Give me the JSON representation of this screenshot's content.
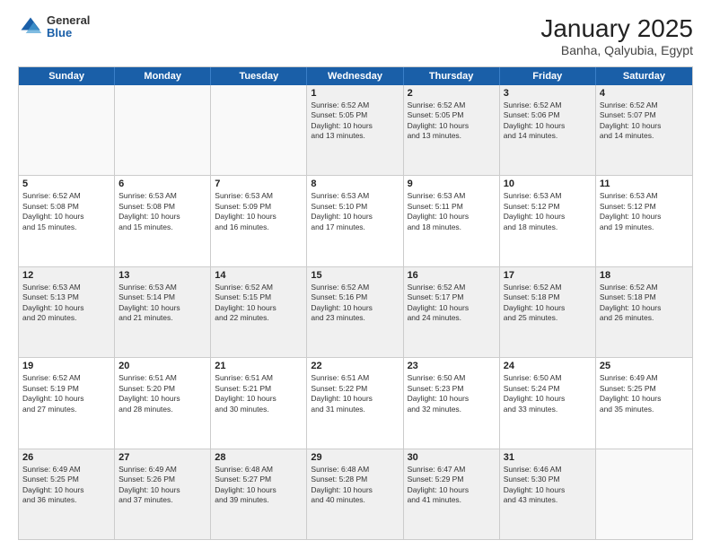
{
  "header": {
    "logo": {
      "general": "General",
      "blue": "Blue"
    },
    "title": "January 2025",
    "subtitle": "Banha, Qalyubia, Egypt"
  },
  "days_of_week": [
    "Sunday",
    "Monday",
    "Tuesday",
    "Wednesday",
    "Thursday",
    "Friday",
    "Saturday"
  ],
  "weeks": [
    [
      {
        "day": "",
        "empty": true
      },
      {
        "day": "",
        "empty": true
      },
      {
        "day": "",
        "empty": true
      },
      {
        "day": "1",
        "lines": [
          "Sunrise: 6:52 AM",
          "Sunset: 5:05 PM",
          "Daylight: 10 hours",
          "and 13 minutes."
        ]
      },
      {
        "day": "2",
        "lines": [
          "Sunrise: 6:52 AM",
          "Sunset: 5:05 PM",
          "Daylight: 10 hours",
          "and 13 minutes."
        ]
      },
      {
        "day": "3",
        "lines": [
          "Sunrise: 6:52 AM",
          "Sunset: 5:06 PM",
          "Daylight: 10 hours",
          "and 14 minutes."
        ]
      },
      {
        "day": "4",
        "lines": [
          "Sunrise: 6:52 AM",
          "Sunset: 5:07 PM",
          "Daylight: 10 hours",
          "and 14 minutes."
        ]
      }
    ],
    [
      {
        "day": "5",
        "lines": [
          "Sunrise: 6:52 AM",
          "Sunset: 5:08 PM",
          "Daylight: 10 hours",
          "and 15 minutes."
        ]
      },
      {
        "day": "6",
        "lines": [
          "Sunrise: 6:53 AM",
          "Sunset: 5:08 PM",
          "Daylight: 10 hours",
          "and 15 minutes."
        ]
      },
      {
        "day": "7",
        "lines": [
          "Sunrise: 6:53 AM",
          "Sunset: 5:09 PM",
          "Daylight: 10 hours",
          "and 16 minutes."
        ]
      },
      {
        "day": "8",
        "lines": [
          "Sunrise: 6:53 AM",
          "Sunset: 5:10 PM",
          "Daylight: 10 hours",
          "and 17 minutes."
        ]
      },
      {
        "day": "9",
        "lines": [
          "Sunrise: 6:53 AM",
          "Sunset: 5:11 PM",
          "Daylight: 10 hours",
          "and 18 minutes."
        ]
      },
      {
        "day": "10",
        "lines": [
          "Sunrise: 6:53 AM",
          "Sunset: 5:12 PM",
          "Daylight: 10 hours",
          "and 18 minutes."
        ]
      },
      {
        "day": "11",
        "lines": [
          "Sunrise: 6:53 AM",
          "Sunset: 5:12 PM",
          "Daylight: 10 hours",
          "and 19 minutes."
        ]
      }
    ],
    [
      {
        "day": "12",
        "lines": [
          "Sunrise: 6:53 AM",
          "Sunset: 5:13 PM",
          "Daylight: 10 hours",
          "and 20 minutes."
        ]
      },
      {
        "day": "13",
        "lines": [
          "Sunrise: 6:53 AM",
          "Sunset: 5:14 PM",
          "Daylight: 10 hours",
          "and 21 minutes."
        ]
      },
      {
        "day": "14",
        "lines": [
          "Sunrise: 6:52 AM",
          "Sunset: 5:15 PM",
          "Daylight: 10 hours",
          "and 22 minutes."
        ]
      },
      {
        "day": "15",
        "lines": [
          "Sunrise: 6:52 AM",
          "Sunset: 5:16 PM",
          "Daylight: 10 hours",
          "and 23 minutes."
        ]
      },
      {
        "day": "16",
        "lines": [
          "Sunrise: 6:52 AM",
          "Sunset: 5:17 PM",
          "Daylight: 10 hours",
          "and 24 minutes."
        ]
      },
      {
        "day": "17",
        "lines": [
          "Sunrise: 6:52 AM",
          "Sunset: 5:18 PM",
          "Daylight: 10 hours",
          "and 25 minutes."
        ]
      },
      {
        "day": "18",
        "lines": [
          "Sunrise: 6:52 AM",
          "Sunset: 5:18 PM",
          "Daylight: 10 hours",
          "and 26 minutes."
        ]
      }
    ],
    [
      {
        "day": "19",
        "lines": [
          "Sunrise: 6:52 AM",
          "Sunset: 5:19 PM",
          "Daylight: 10 hours",
          "and 27 minutes."
        ]
      },
      {
        "day": "20",
        "lines": [
          "Sunrise: 6:51 AM",
          "Sunset: 5:20 PM",
          "Daylight: 10 hours",
          "and 28 minutes."
        ]
      },
      {
        "day": "21",
        "lines": [
          "Sunrise: 6:51 AM",
          "Sunset: 5:21 PM",
          "Daylight: 10 hours",
          "and 30 minutes."
        ]
      },
      {
        "day": "22",
        "lines": [
          "Sunrise: 6:51 AM",
          "Sunset: 5:22 PM",
          "Daylight: 10 hours",
          "and 31 minutes."
        ]
      },
      {
        "day": "23",
        "lines": [
          "Sunrise: 6:50 AM",
          "Sunset: 5:23 PM",
          "Daylight: 10 hours",
          "and 32 minutes."
        ]
      },
      {
        "day": "24",
        "lines": [
          "Sunrise: 6:50 AM",
          "Sunset: 5:24 PM",
          "Daylight: 10 hours",
          "and 33 minutes."
        ]
      },
      {
        "day": "25",
        "lines": [
          "Sunrise: 6:49 AM",
          "Sunset: 5:25 PM",
          "Daylight: 10 hours",
          "and 35 minutes."
        ]
      }
    ],
    [
      {
        "day": "26",
        "lines": [
          "Sunrise: 6:49 AM",
          "Sunset: 5:25 PM",
          "Daylight: 10 hours",
          "and 36 minutes."
        ]
      },
      {
        "day": "27",
        "lines": [
          "Sunrise: 6:49 AM",
          "Sunset: 5:26 PM",
          "Daylight: 10 hours",
          "and 37 minutes."
        ]
      },
      {
        "day": "28",
        "lines": [
          "Sunrise: 6:48 AM",
          "Sunset: 5:27 PM",
          "Daylight: 10 hours",
          "and 39 minutes."
        ]
      },
      {
        "day": "29",
        "lines": [
          "Sunrise: 6:48 AM",
          "Sunset: 5:28 PM",
          "Daylight: 10 hours",
          "and 40 minutes."
        ]
      },
      {
        "day": "30",
        "lines": [
          "Sunrise: 6:47 AM",
          "Sunset: 5:29 PM",
          "Daylight: 10 hours",
          "and 41 minutes."
        ]
      },
      {
        "day": "31",
        "lines": [
          "Sunrise: 6:46 AM",
          "Sunset: 5:30 PM",
          "Daylight: 10 hours",
          "and 43 minutes."
        ]
      },
      {
        "day": "",
        "empty": true
      }
    ]
  ]
}
